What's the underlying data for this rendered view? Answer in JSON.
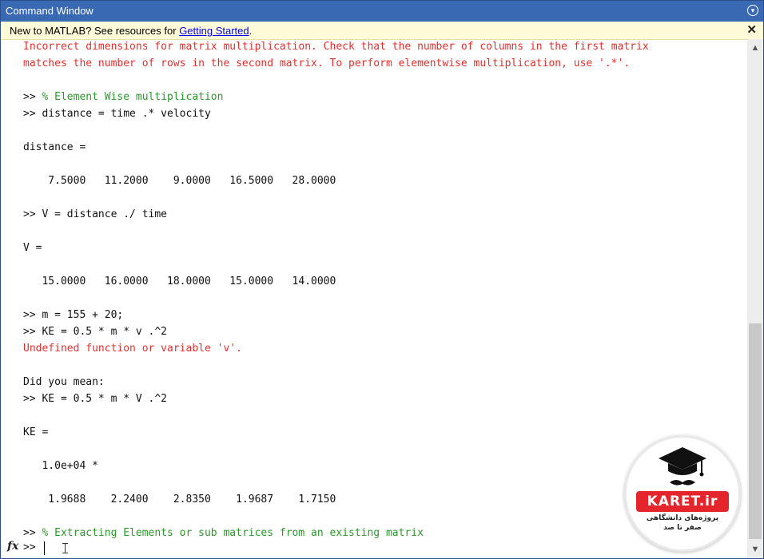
{
  "window": {
    "title": "Command Window"
  },
  "banner": {
    "text": "New to MATLAB? See resources for ",
    "link": "Getting Started",
    "suffix": "."
  },
  "lines": [
    {
      "text": "Incorrect dimensions for matrix multiplication. Check that the number of columns in the first matrix",
      "kind": "err"
    },
    {
      "text": "matches the number of rows in the second matrix. To perform elementwise multiplication, use '.*'.",
      "kind": "err"
    },
    {
      "text": "",
      "kind": "out"
    },
    {
      "text": ">> ",
      "kind": "out",
      "comment": "% Element Wise multiplication"
    },
    {
      "text": ">> distance = time .* velocity",
      "kind": "out"
    },
    {
      "text": "",
      "kind": "out"
    },
    {
      "text": "distance =",
      "kind": "out"
    },
    {
      "text": "",
      "kind": "out"
    },
    {
      "text": "    7.5000   11.2000    9.0000   16.5000   28.0000",
      "kind": "out"
    },
    {
      "text": "",
      "kind": "out"
    },
    {
      "text": ">> V = distance ./ time",
      "kind": "out"
    },
    {
      "text": "",
      "kind": "out"
    },
    {
      "text": "V =",
      "kind": "out"
    },
    {
      "text": "",
      "kind": "out"
    },
    {
      "text": "   15.0000   16.0000   18.0000   15.0000   14.0000",
      "kind": "out"
    },
    {
      "text": "",
      "kind": "out"
    },
    {
      "text": ">> m = 155 + 20;",
      "kind": "out"
    },
    {
      "text": ">> KE = 0.5 * m * v .^2",
      "kind": "out"
    },
    {
      "text": "Undefined function or variable 'v'.",
      "kind": "err"
    },
    {
      "text": "",
      "kind": "out"
    },
    {
      "text": "Did you mean:",
      "kind": "out"
    },
    {
      "text": ">> KE = 0.5 * m * V .^2",
      "kind": "out"
    },
    {
      "text": "",
      "kind": "out"
    },
    {
      "text": "KE =",
      "kind": "out"
    },
    {
      "text": "",
      "kind": "out"
    },
    {
      "text": "   1.0e+04 *",
      "kind": "out"
    },
    {
      "text": "",
      "kind": "out"
    },
    {
      "text": "    1.9688    2.2400    2.8350    1.9687    1.7150",
      "kind": "out"
    },
    {
      "text": "",
      "kind": "out"
    },
    {
      "text": ">> ",
      "kind": "out",
      "comment": "% Extracting Elements or sub matrices from an existing matrix"
    }
  ],
  "input": {
    "fx": "fx",
    "prompt": ">>"
  },
  "watermark": {
    "brand": "KARET.ir",
    "line1": "پروژه‌های دانشگاهی",
    "line2": "صفر تا صد"
  },
  "colors": {
    "error": "#e03030",
    "comment": "#2a9a2a",
    "title_bar": "#3a69b3",
    "banner_bg": "#fffbd9"
  }
}
